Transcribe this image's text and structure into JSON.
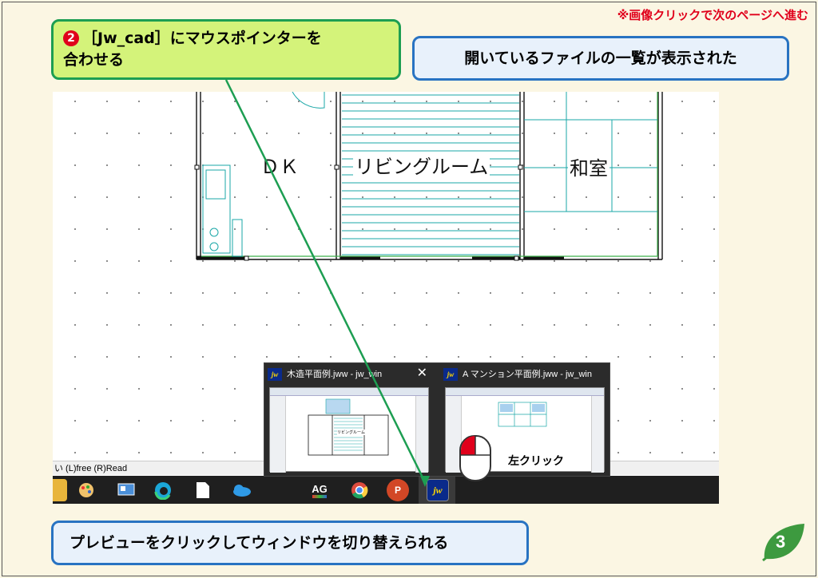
{
  "top_note": "※画像クリックで次のページへ進む",
  "step": {
    "number": "2",
    "line1": "［Jw_cad］にマウスポインターを",
    "line2": "合わせる"
  },
  "info_top": "開いているファイルの一覧が表示された",
  "info_bottom": "プレビューをクリックしてウィンドウを切り替えられる",
  "page_number": "3",
  "drawing": {
    "labels": {
      "dk": "ＤＫ",
      "living": "リビングルーム",
      "washitsu": "和室"
    }
  },
  "status_bar": "い (L)free (R)Read",
  "taskbar": {
    "items": [
      {
        "name": "paint-icon",
        "label": ""
      },
      {
        "name": "app-icon",
        "label": ""
      },
      {
        "name": "edge-icon",
        "label": ""
      },
      {
        "name": "file-icon",
        "label": ""
      },
      {
        "name": "onedrive-icon",
        "label": ""
      },
      {
        "name": "ag-icon",
        "label": "AG"
      },
      {
        "name": "chrome-icon",
        "label": ""
      },
      {
        "name": "powerpoint-icon",
        "label": "P"
      },
      {
        "name": "jwcad-icon",
        "label": "jw"
      }
    ]
  },
  "previews": [
    {
      "title": "木造平面例.jww - jw_win",
      "thumb_label": "リビングルーム",
      "has_close": true
    },
    {
      "title": "A マンション平面例.jww - jw_win",
      "thumb_label": "",
      "has_close": false
    }
  ],
  "jw_icon_text": "jw",
  "close_symbol": "✕",
  "left_click_label": "左クリック",
  "colors": {
    "accent_red": "#e0001b",
    "step_green": "#1d9e52",
    "info_blue": "#2873c2",
    "leaf_green": "#3d9a3f",
    "drawing_cyan": "#1aa7a7"
  }
}
